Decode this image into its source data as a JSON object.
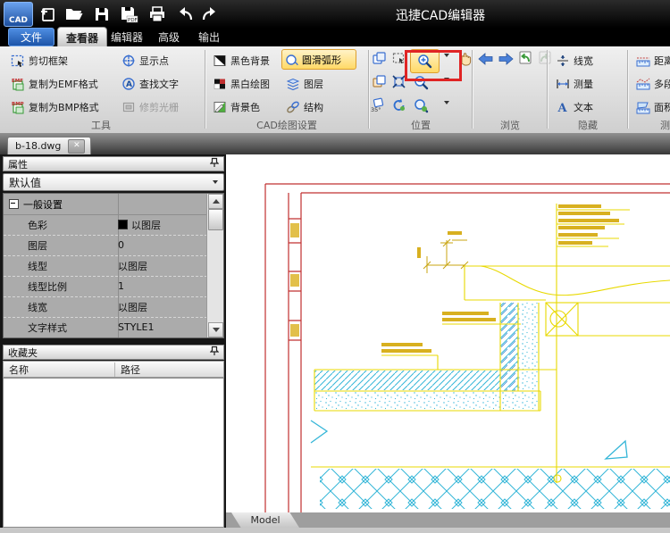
{
  "titlebar": {
    "title": "迅捷CAD编辑器",
    "logo": "CAD"
  },
  "menubar": {
    "file_button": "文件",
    "tabs": [
      {
        "label": "查看器",
        "active": true
      },
      {
        "label": "编辑器",
        "active": false
      },
      {
        "label": "高级",
        "active": false
      },
      {
        "label": "输出",
        "active": false
      }
    ]
  },
  "ribbon": {
    "tools_group": {
      "label": "工具",
      "items": [
        {
          "label": "剪切框架"
        },
        {
          "label": "复制为EMF格式"
        },
        {
          "label": "复制为BMP格式"
        },
        {
          "label": "显示点"
        },
        {
          "label": "查找文字"
        },
        {
          "label": "修剪光栅",
          "disabled": true
        }
      ]
    },
    "cad_settings_group": {
      "label": "CAD绘图设置",
      "items": [
        {
          "label": "黑色背景"
        },
        {
          "label": "黑白绘图"
        },
        {
          "label": "背景色"
        },
        {
          "label": "圆滑弧形",
          "highlighted": true
        },
        {
          "label": "图层"
        },
        {
          "label": "结构"
        }
      ]
    },
    "position_group": {
      "label": "位置"
    },
    "browse_group": {
      "label": "浏览"
    },
    "hide_group": {
      "label": "隐藏",
      "items": [
        {
          "label": "线宽"
        },
        {
          "label": "测量"
        },
        {
          "label": "文本"
        }
      ]
    },
    "measure_group": {
      "label": "测量",
      "items": [
        {
          "label": "距离"
        },
        {
          "label": "多段线"
        },
        {
          "label": "面积"
        }
      ]
    }
  },
  "document_tab": {
    "label": "b-18.dwg"
  },
  "properties_panel": {
    "title": "属性",
    "preset_value": "默认值",
    "section": "一般设置",
    "rows": [
      {
        "label": "色彩",
        "value": "以图层"
      },
      {
        "label": "图层",
        "value": "0"
      },
      {
        "label": "线型",
        "value": "以图层"
      },
      {
        "label": "线型比例",
        "value": "1"
      },
      {
        "label": "线宽",
        "value": "以图层"
      },
      {
        "label": "文字样式",
        "value": "STYLE1"
      }
    ]
  },
  "favorites_panel": {
    "title": "收藏夹",
    "columns": {
      "name": "名称",
      "path": "路径"
    }
  },
  "statusbar": {
    "model_tab": "Model"
  },
  "colors": {
    "cad_yellow": "#e8d900",
    "cad_annotation": "#d8b020",
    "cad_cyan": "#35b6d8",
    "frame_red": "#c03030",
    "highlight_border": "#dd9f2e",
    "annotation_box_red": "#e02424",
    "accent_blue": "#2f6fd0"
  }
}
